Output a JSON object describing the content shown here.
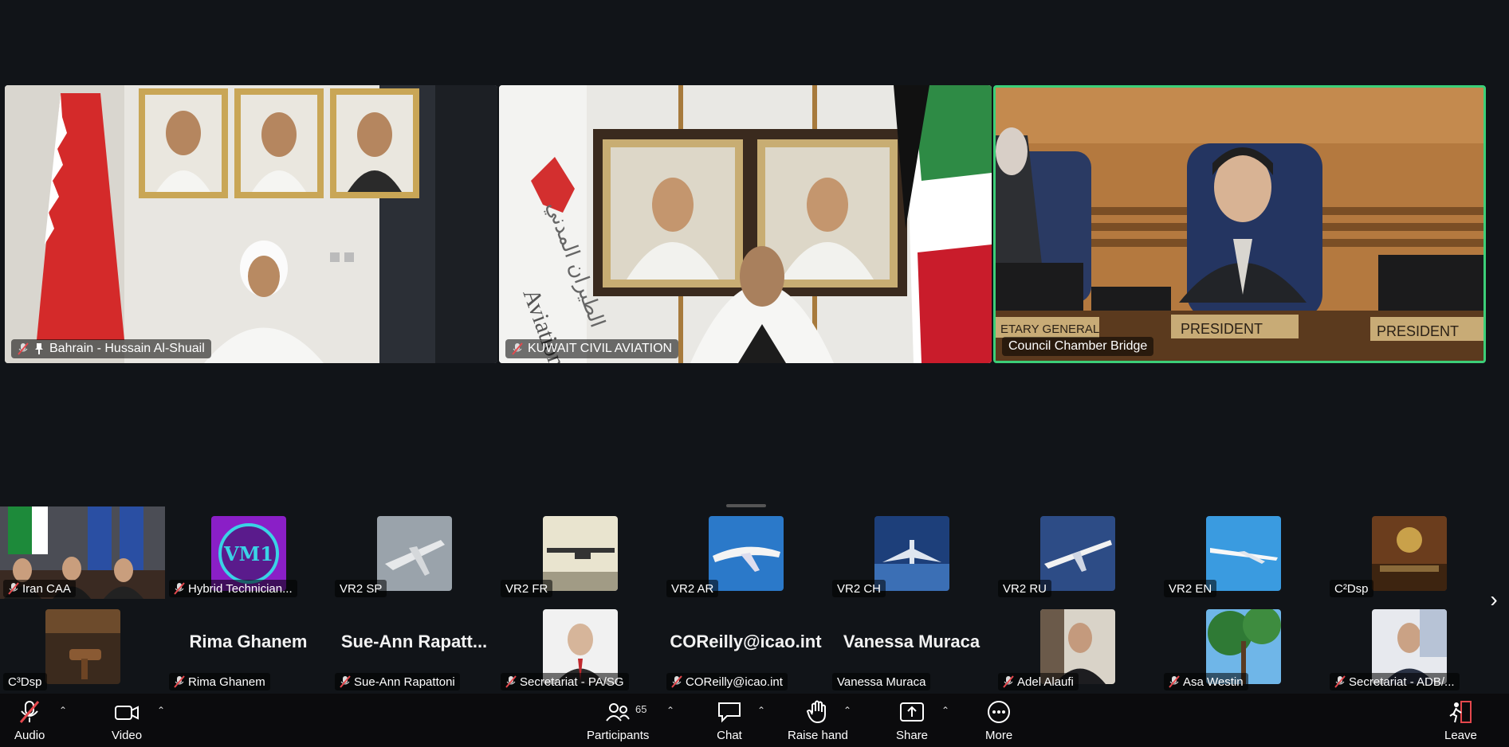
{
  "main_tiles": [
    {
      "name": "Bahrain - Hussain Al-Shuail",
      "pinned": true,
      "muted": true
    },
    {
      "name": "KUWAIT CIVIL AVIATION",
      "muted": true
    },
    {
      "name": "Council Chamber Bridge",
      "active": true
    }
  ],
  "chamber_text": {
    "secretary": "ETARY GENERAL",
    "president1": "PRESIDENT",
    "president2": "PRESIDENT"
  },
  "logo_text": {
    "aviation": "Aviation",
    "arabic": "الطيران المدني"
  },
  "thumbs_row1": [
    {
      "name": "Iran CAA",
      "muted": true
    },
    {
      "name": "Hybrid Technician...",
      "muted": true,
      "logo": "VM1"
    },
    {
      "name": "VR2 SP"
    },
    {
      "name": "VR2 FR"
    },
    {
      "name": "VR2 AR"
    },
    {
      "name": "VR2 CH"
    },
    {
      "name": "VR2 RU"
    },
    {
      "name": "VR2 EN"
    },
    {
      "name": "C²Dsp"
    }
  ],
  "thumbs_row2": [
    {
      "name": "C³Dsp"
    },
    {
      "name": "Rima Ghanem",
      "muted": true,
      "big": "Rima Ghanem"
    },
    {
      "name": "Sue-Ann Rapattoni",
      "muted": true,
      "big": "Sue-Ann  Rapatt..."
    },
    {
      "name": "Secretariat - PA/SG",
      "muted": true
    },
    {
      "name": "COReilly@icao.int",
      "muted": true,
      "big": "COReilly@icao.int"
    },
    {
      "name": "Vanessa Muraca",
      "big": "Vanessa Muraca"
    },
    {
      "name": "Adel Alaufi",
      "muted": true
    },
    {
      "name": "Asa Westin",
      "muted": true
    },
    {
      "name": "Secretariat - ADB/...",
      "muted": true
    }
  ],
  "toolbar": {
    "audio": "Audio",
    "video": "Video",
    "participants": "Participants",
    "participants_count": "65",
    "chat": "Chat",
    "raise_hand": "Raise hand",
    "share": "Share",
    "more": "More",
    "leave": "Leave"
  },
  "colors": {
    "background": "#111418",
    "active_border": "#3ccf78",
    "mute_red": "#e5484d",
    "toolbar": "#0b0b0d"
  },
  "icons": [
    "mic-muted-icon",
    "video-icon",
    "participants-icon",
    "chat-icon",
    "raise-hand-icon",
    "share-icon",
    "more-icon",
    "leave-icon",
    "pin-icon",
    "chevron-right-icon"
  ]
}
